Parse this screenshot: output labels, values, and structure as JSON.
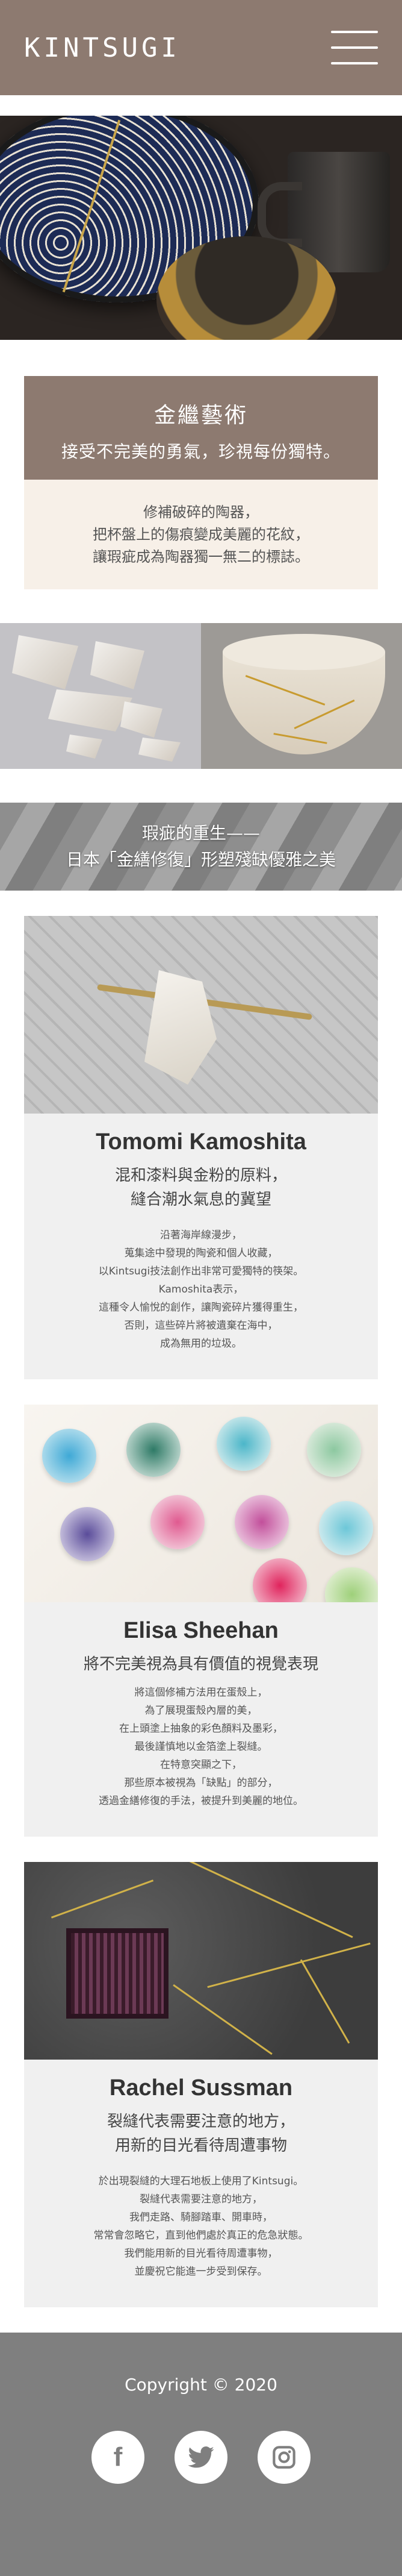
{
  "header": {
    "logo": "KINTSUGI",
    "menu_icon": "hamburger-menu-icon"
  },
  "intro": {
    "title": "金繼藝術",
    "subtitle": "接受不完美的勇氣，珍視每份獨特。",
    "lines": [
      "修補破碎的陶器，",
      "把杯盤上的傷痕變成美麗的花紋，",
      "讓瑕疵成為陶器獨一無二的標誌。"
    ]
  },
  "banner": {
    "line1": "瑕疵的重生——",
    "line2": "日本「金繕修復」形塑殘缺優雅之美"
  },
  "cards": [
    {
      "name": "Tomomi Kamoshita",
      "sub1": "混和漆料與金粉的原料，",
      "sub2": "縫合潮水氣息的冀望",
      "text": [
        "沿著海岸線漫步，",
        "蒐集途中發現的陶瓷和個人收藏，",
        "以Kintsugi技法創作出非常可愛獨特的筷架。",
        "Kamoshita表示，",
        "這種令人愉悅的創作，讓陶瓷碎片獲得重生，",
        "否則，這些碎片將被遺棄在海中，",
        "成為無用的垃圾。"
      ]
    },
    {
      "name": "Elisa Sheehan",
      "sub1": "將不完美視為具有價值的視覺表現",
      "sub2": "",
      "text": [
        "將這個修補方法用在蛋殼上，",
        "為了展現蛋殼內層的美，",
        "在上頭塗上抽象的彩色顏料及墨彩，",
        "最後謹慎地以金箔塗上裂縫。",
        "在特意突顯之下，",
        "那些原本被視為「缺點」的部分，",
        "透過金繕修復的手法，被提升到美麗的地位。"
      ]
    },
    {
      "name": "Rachel Sussman",
      "sub1": "裂縫代表需要注意的地方，",
      "sub2": "用新的目光看待周遭事物",
      "text": [
        "於出現裂縫的大理石地板上使用了Kintsugi。",
        "裂縫代表需要注意的地方，",
        "我們走路、騎腳踏車、開車時，",
        "常常會忽略它，直到他們處於真正的危急狀態。",
        "我們能用新的目光看待周遭事物，",
        "並慶祝它能進一步受到保存。"
      ]
    }
  ],
  "footer": {
    "copyright": "Copyright © 2020",
    "social": [
      "f",
      "t",
      "ig"
    ]
  },
  "colors": {
    "brand": "#8d7a70",
    "cream": "#f7f0e8",
    "footer": "#7f7f7f",
    "card": "#f0f0f0"
  }
}
